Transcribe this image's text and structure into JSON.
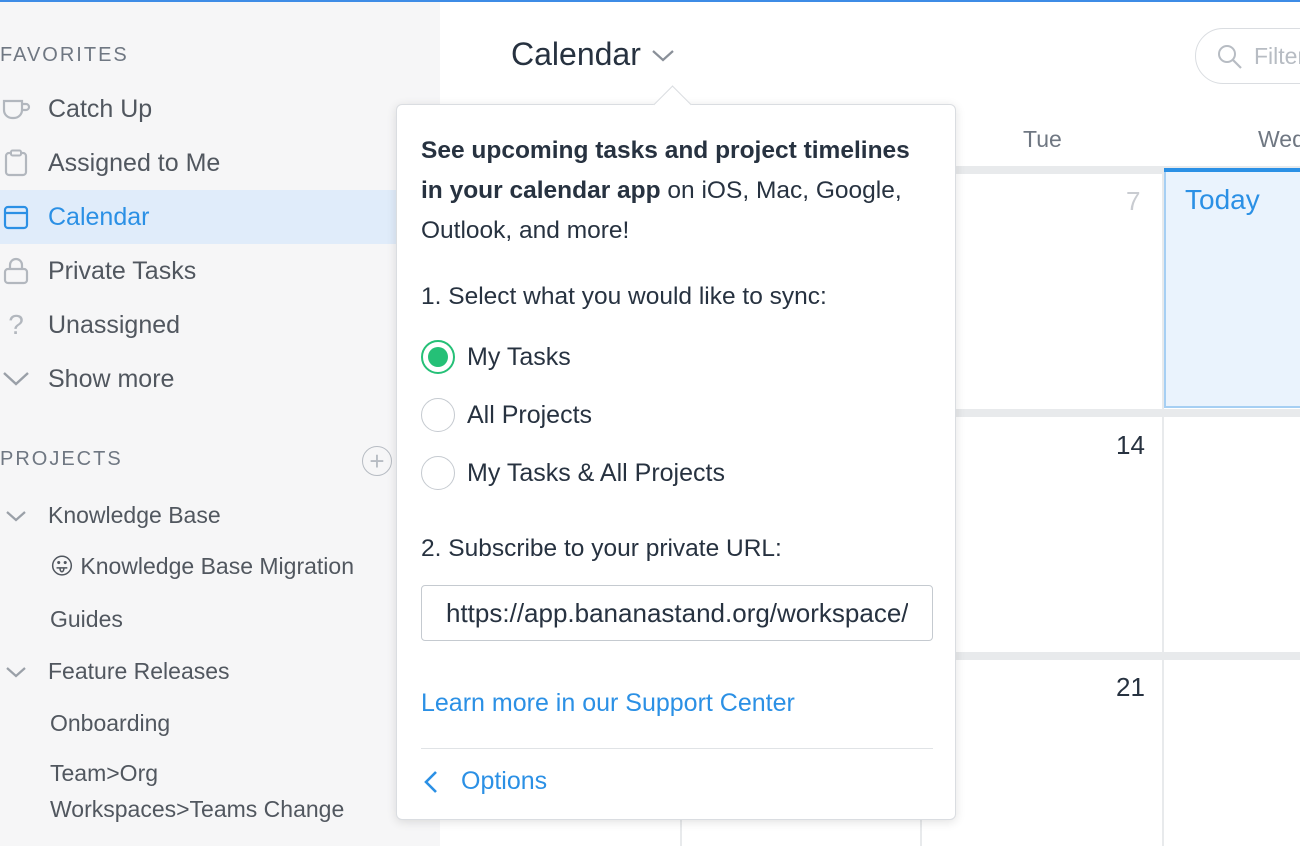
{
  "sidebar": {
    "favorites_title": "FAVORITES",
    "favorites": [
      {
        "label": "Catch Up",
        "icon": "coffee-cup-icon"
      },
      {
        "label": "Assigned to Me",
        "icon": "clipboard-icon"
      },
      {
        "label": "Calendar",
        "icon": "calendar-icon",
        "active": true
      },
      {
        "label": "Private Tasks",
        "icon": "lock-icon"
      },
      {
        "label": "Unassigned",
        "icon": "question-icon"
      },
      {
        "label": "Show more",
        "icon": "chevron-down-icon"
      }
    ],
    "projects_title": "PROJECTS",
    "projects": [
      {
        "label": "Knowledge Base",
        "expanded": true
      },
      {
        "label": "Knowledge Base Migration",
        "emoji": "😛"
      },
      {
        "label": "Guides"
      },
      {
        "label": "Feature Releases",
        "expanded": true
      },
      {
        "label": "Onboarding"
      },
      {
        "label": "Team>Org"
      },
      {
        "label": "Workspaces>Teams Change"
      }
    ]
  },
  "header": {
    "title": "Calendar",
    "filter_placeholder": "Filter"
  },
  "calendar": {
    "day_headers": [
      "Tue",
      "Wed"
    ],
    "today_label": "Today",
    "dates": [
      "7",
      "14",
      "21"
    ]
  },
  "popover": {
    "desc_bold": "See upcoming tasks and project timelines in your calendar app",
    "desc_rest": " on iOS, Mac, Google, Outlook, and more!",
    "step1": "1. Select what you would like to sync:",
    "options": [
      {
        "label": "My Tasks",
        "checked": true
      },
      {
        "label": "All Projects",
        "checked": false
      },
      {
        "label": "My Tasks & All Projects",
        "checked": false
      }
    ],
    "step2": "2. Subscribe to your private URL:",
    "url_value": "https://app.bananastand.org/workspace/calendar",
    "learn_more": "Learn more in our Support Center",
    "options_link": "Options"
  },
  "colors": {
    "accent": "#2b90e5",
    "check_green": "#25c077",
    "top_bar": "#3e8ce6"
  }
}
